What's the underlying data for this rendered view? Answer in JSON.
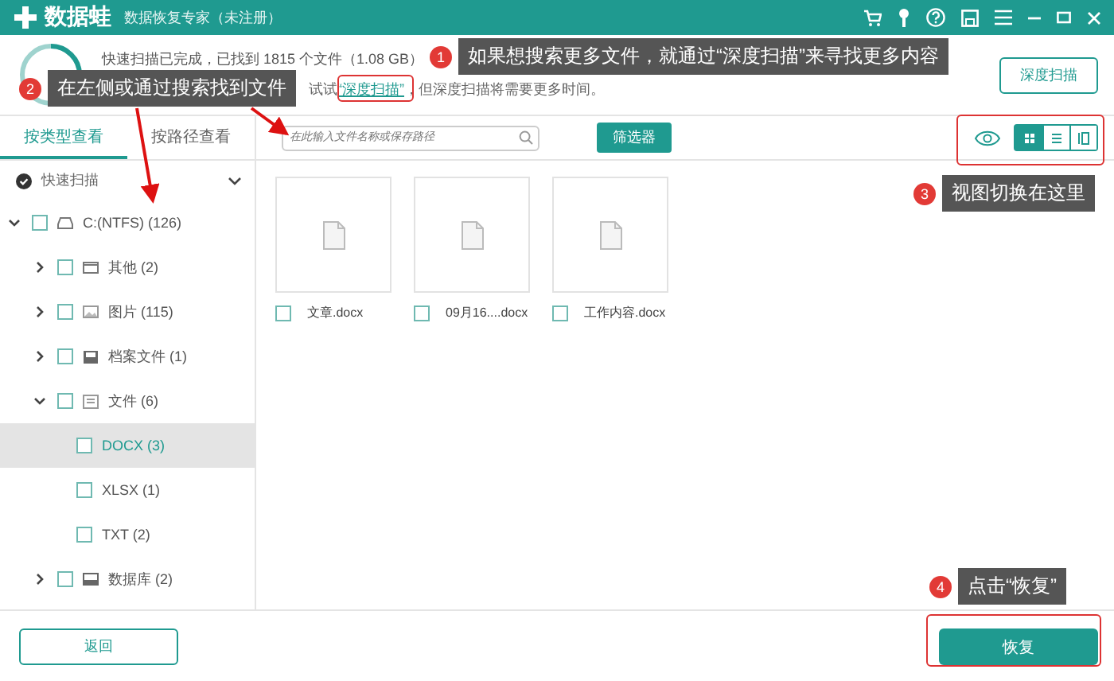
{
  "window": {
    "title": "数据蛙",
    "subtitle": "数据恢复专家（未注册）"
  },
  "status": {
    "line1": "快速扫描已完成，已找到 1815 个文件（1.08 GB）",
    "line2_before": "试试",
    "line2_link": "“深度扫描”",
    "line2_after": "，但深度扫描将需要更多时间。",
    "deep_scan_button": "深度扫描"
  },
  "tabs": [
    {
      "label": "按类型查看",
      "selected": true
    },
    {
      "label": "按路径查看",
      "selected": false
    }
  ],
  "scan_mode": {
    "label": "快速扫描"
  },
  "tree": [
    {
      "label": "C:(NTFS) (126)",
      "kind": "drive",
      "expanded": true,
      "checked": false,
      "selected": false,
      "children": [
        {
          "label": "其他 (2)",
          "kind": "folder",
          "expanded": false,
          "checked": false,
          "selected": false
        },
        {
          "label": "图片 (115)",
          "kind": "image",
          "expanded": false,
          "checked": false,
          "selected": false
        },
        {
          "label": "档案文件 (1)",
          "kind": "archive",
          "expanded": false,
          "checked": false,
          "selected": false
        },
        {
          "label": "文件 (6)",
          "kind": "document",
          "expanded": true,
          "checked": false,
          "selected": false,
          "children": [
            {
              "label": "DOCX (3)",
              "checked": false,
              "selected": true
            },
            {
              "label": "XLSX (1)",
              "checked": false,
              "selected": false
            },
            {
              "label": "TXT (2)",
              "checked": false,
              "selected": false
            }
          ]
        },
        {
          "label": "数据库 (2)",
          "kind": "database",
          "expanded": false,
          "checked": false,
          "selected": false
        }
      ]
    }
  ],
  "search": {
    "placeholder": "在此输入文件名称或保存路径"
  },
  "filter_button": "筛选器",
  "views": [
    {
      "kind": "grid",
      "selected": true
    },
    {
      "kind": "list",
      "selected": false
    },
    {
      "kind": "detail",
      "selected": false
    }
  ],
  "files": [
    {
      "name": "文章.docx",
      "checked": false
    },
    {
      "name": "09月16....docx",
      "checked": false
    },
    {
      "name": "工作内容.docx",
      "checked": false
    }
  ],
  "back_button": "返回",
  "recover_button": "恢复",
  "annotations": [
    {
      "number": "1",
      "text": "如果想搜索更多文件，就通过“深度扫描”来寻找更多内容"
    },
    {
      "number": "2",
      "text": "在左侧或通过搜索找到文件"
    },
    {
      "number": "3",
      "text": "视图切换在这里"
    },
    {
      "number": "4",
      "text": "点击“恢复”"
    }
  ]
}
